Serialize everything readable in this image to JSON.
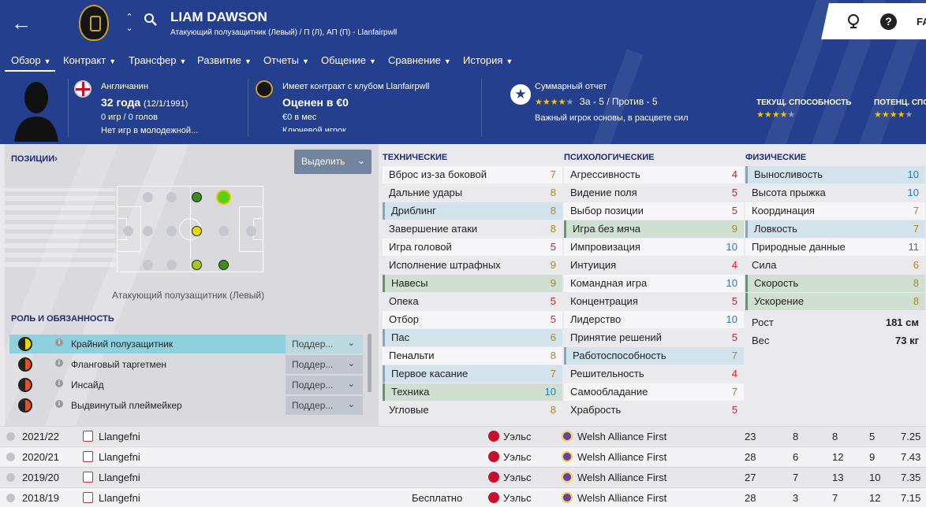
{
  "header": {
    "player_name": "LIAM DAWSON",
    "subtitle": "Атакующий полузащитник (Левый) / П (Л), АП (П) - Llanfairpwll",
    "top_right_partial": "FA"
  },
  "menu": [
    {
      "label": "Обзор"
    },
    {
      "label": "Контракт"
    },
    {
      "label": "Трансфер"
    },
    {
      "label": "Развитие"
    },
    {
      "label": "Отчеты"
    },
    {
      "label": "Общение"
    },
    {
      "label": "Сравнение"
    },
    {
      "label": "История"
    }
  ],
  "info": {
    "nationality": "Англичанин",
    "age": "32 года",
    "birthdate": "(12/1/1991)",
    "intl": "0 игр / 0 голов",
    "youth": "Нет игр в молодежной...",
    "contract": "Имеет контракт с клубом Llanfairpwll",
    "value": "Оценен в €0",
    "wage": "€0 в мес",
    "squad_status_partial": "Ключевой игрок",
    "report_title": "Суммарный отчет",
    "report_stars": 4,
    "report_pros_cons": "За - 5 / Против - 5",
    "report_text": "Важный игрок основы, в расцвете сил",
    "current_ability_label": "ТЕКУЩ. СПОСОБНОСТЬ",
    "current_ability_stars": 4,
    "potential_ability_label": "ПОТЕНЦ. СПОС",
    "potential_ability_stars": 4
  },
  "positions": {
    "title": "ПОЗИЦИИ",
    "select_label": "Выделить",
    "position_name": "Атакующий полузащитник (Левый)"
  },
  "roles": {
    "title": "РОЛЬ И ОБЯЗАННОСТЬ",
    "items": [
      {
        "name": "Крайний полузащитник",
        "duty": "Поддер...",
        "selected": true,
        "color": "#e6d900"
      },
      {
        "name": "Фланговый таргетмен",
        "duty": "Поддер...",
        "selected": false,
        "color": "#e0532a"
      },
      {
        "name": "Инсайд",
        "duty": "Поддер...",
        "selected": false,
        "color": "#e0532a"
      },
      {
        "name": "Выдвинутый плеймейкер",
        "duty": "Поддер...",
        "selected": false,
        "color": "#e0532a"
      }
    ]
  },
  "attributes": {
    "technical": {
      "title": "ТЕХНИЧЕСКИЕ",
      "items": [
        {
          "name": "Вброс из-за боковой",
          "value": "7",
          "hl": ""
        },
        {
          "name": "Дальние удары",
          "value": "8",
          "hl": ""
        },
        {
          "name": "Дриблинг",
          "value": "8",
          "hl": "blue"
        },
        {
          "name": "Завершение атаки",
          "value": "8",
          "hl": ""
        },
        {
          "name": "Игра головой",
          "value": "5",
          "hl": ""
        },
        {
          "name": "Исполнение штрафных",
          "value": "9",
          "hl": ""
        },
        {
          "name": "Навесы",
          "value": "9",
          "hl": "green"
        },
        {
          "name": "Опека",
          "value": "5",
          "hl": ""
        },
        {
          "name": "Отбор",
          "value": "5",
          "hl": ""
        },
        {
          "name": "Пас",
          "value": "6",
          "hl": "blue"
        },
        {
          "name": "Пенальти",
          "value": "8",
          "hl": ""
        },
        {
          "name": "Первое касание",
          "value": "7",
          "hl": "blue"
        },
        {
          "name": "Техника",
          "value": "10",
          "hl": "green"
        },
        {
          "name": "Угловые",
          "value": "8",
          "hl": ""
        }
      ]
    },
    "mental": {
      "title": "ПСИХОЛОГИЧЕСКИЕ",
      "items": [
        {
          "name": "Агрессивность",
          "value": "4",
          "hl": ""
        },
        {
          "name": "Видение поля",
          "value": "5",
          "hl": ""
        },
        {
          "name": "Выбор позиции",
          "value": "5",
          "hl": ""
        },
        {
          "name": "Игра без мяча",
          "value": "9",
          "hl": "green"
        },
        {
          "name": "Импровизация",
          "value": "10",
          "hl": ""
        },
        {
          "name": "Интуиция",
          "value": "4",
          "hl": ""
        },
        {
          "name": "Командная игра",
          "value": "10",
          "hl": ""
        },
        {
          "name": "Концентрация",
          "value": "5",
          "hl": ""
        },
        {
          "name": "Лидерство",
          "value": "10",
          "hl": ""
        },
        {
          "name": "Принятие решений",
          "value": "5",
          "hl": ""
        },
        {
          "name": "Работоспособность",
          "value": "7",
          "hl": "blue"
        },
        {
          "name": "Решительность",
          "value": "4",
          "hl": ""
        },
        {
          "name": "Самообладание",
          "value": "7",
          "hl": ""
        },
        {
          "name": "Храбрость",
          "value": "5",
          "hl": ""
        }
      ]
    },
    "physical": {
      "title": "ФИЗИЧЕСКИЕ",
      "items": [
        {
          "name": "Выносливость",
          "value": "10",
          "hl": "blue"
        },
        {
          "name": "Высота прыжка",
          "value": "10",
          "hl": ""
        },
        {
          "name": "Координация",
          "value": "7",
          "hl": ""
        },
        {
          "name": "Ловкость",
          "value": "7",
          "hl": "blue"
        },
        {
          "name": "Природные данные",
          "value": "11",
          "hl": ""
        },
        {
          "name": "Сила",
          "value": "6",
          "hl": ""
        },
        {
          "name": "Скорость",
          "value": "8",
          "hl": "green"
        },
        {
          "name": "Ускорение",
          "value": "8",
          "hl": "green"
        }
      ]
    },
    "height_label": "Рост",
    "height_value": "181 см",
    "weight_label": "Вес",
    "weight_value": "73 кг"
  },
  "history": [
    {
      "season": "2021/22",
      "club": "Llangefni",
      "fee": "",
      "nation": "Уэльс",
      "league": "Welsh Alliance First",
      "c1": "23",
      "c2": "8",
      "c3": "8",
      "c4": "5",
      "c5": "7.25"
    },
    {
      "season": "2020/21",
      "club": "Llangefni",
      "fee": "",
      "nation": "Уэльс",
      "league": "Welsh Alliance First",
      "c1": "28",
      "c2": "6",
      "c3": "12",
      "c4": "9",
      "c5": "7.43"
    },
    {
      "season": "2019/20",
      "club": "Llangefni",
      "fee": "",
      "nation": "Уэльс",
      "league": "Welsh Alliance First",
      "c1": "27",
      "c2": "7",
      "c3": "13",
      "c4": "10",
      "c5": "7.35"
    },
    {
      "season": "2018/19",
      "club": "Llangefni",
      "fee": "Бесплатно",
      "nation": "Уэльс",
      "league": "Welsh Alliance First",
      "c1": "28",
      "c2": "3",
      "c3": "7",
      "c4": "12",
      "c5": "7.15"
    }
  ],
  "colors": {
    "header_bg": "#243f8e",
    "value_high": "#1a7fd4",
    "value_mid": "#b8860b",
    "value_low": "#d32020",
    "hl_blue": "#d3e3ee",
    "hl_green": "#cfe0d3",
    "star_on": "#f4c20d"
  }
}
